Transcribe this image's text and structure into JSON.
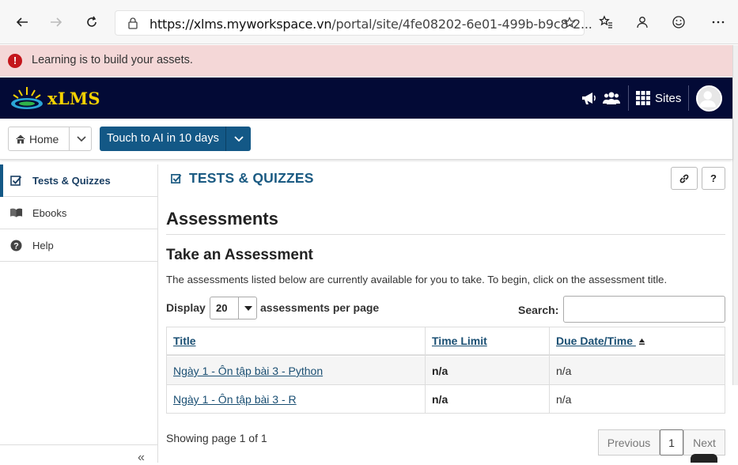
{
  "browser": {
    "url_host": "https://xlms.myworkspace.vn",
    "url_path": "/portal/site/4fe08202-6e01-499b-b9c8-2..."
  },
  "banner": {
    "text": "Learning is to build your assets.",
    "icon": "error-icon"
  },
  "header": {
    "logo_text": "xLMS",
    "sites_label": "Sites",
    "icons": [
      "megaphone-icon",
      "users-icon",
      "grid-icon",
      "avatar"
    ]
  },
  "sitenav": {
    "home_label": "Home",
    "site_label": "Touch to AI in 10 days"
  },
  "sidebar": {
    "items": [
      {
        "label": "Tests & Quizzes",
        "icon": "check-square-icon",
        "active": true
      },
      {
        "label": "Ebooks",
        "icon": "book-icon",
        "active": false
      },
      {
        "label": "Help",
        "icon": "help-circle-icon",
        "active": false
      }
    ],
    "collapse_label": "«"
  },
  "tool": {
    "title": "TESTS & QUIZZES",
    "link_button": "link-icon",
    "help_button": "?"
  },
  "main": {
    "heading": "Assessments",
    "subheading": "Take an Assessment",
    "intro": "The assessments listed below are currently available for you to take. To begin, click on the assessment title.",
    "display_label": "Display",
    "page_size": "20",
    "per_page_label": "assessments per page",
    "search_label": "Search:",
    "search_value": ""
  },
  "table": {
    "columns": [
      "Title",
      "Time Limit",
      "Due Date/Time"
    ],
    "rows": [
      {
        "title": "Ngày 1 - Ôn tập bài 3 - Python",
        "time_limit": "n/a",
        "due": "n/a"
      },
      {
        "title": "Ngày 1 - Ôn tập bài 3 - R",
        "time_limit": "n/a",
        "due": "n/a"
      }
    ]
  },
  "pager": {
    "status": "Showing page 1 of 1",
    "previous": "Previous",
    "current": "1",
    "next": "Next"
  }
}
